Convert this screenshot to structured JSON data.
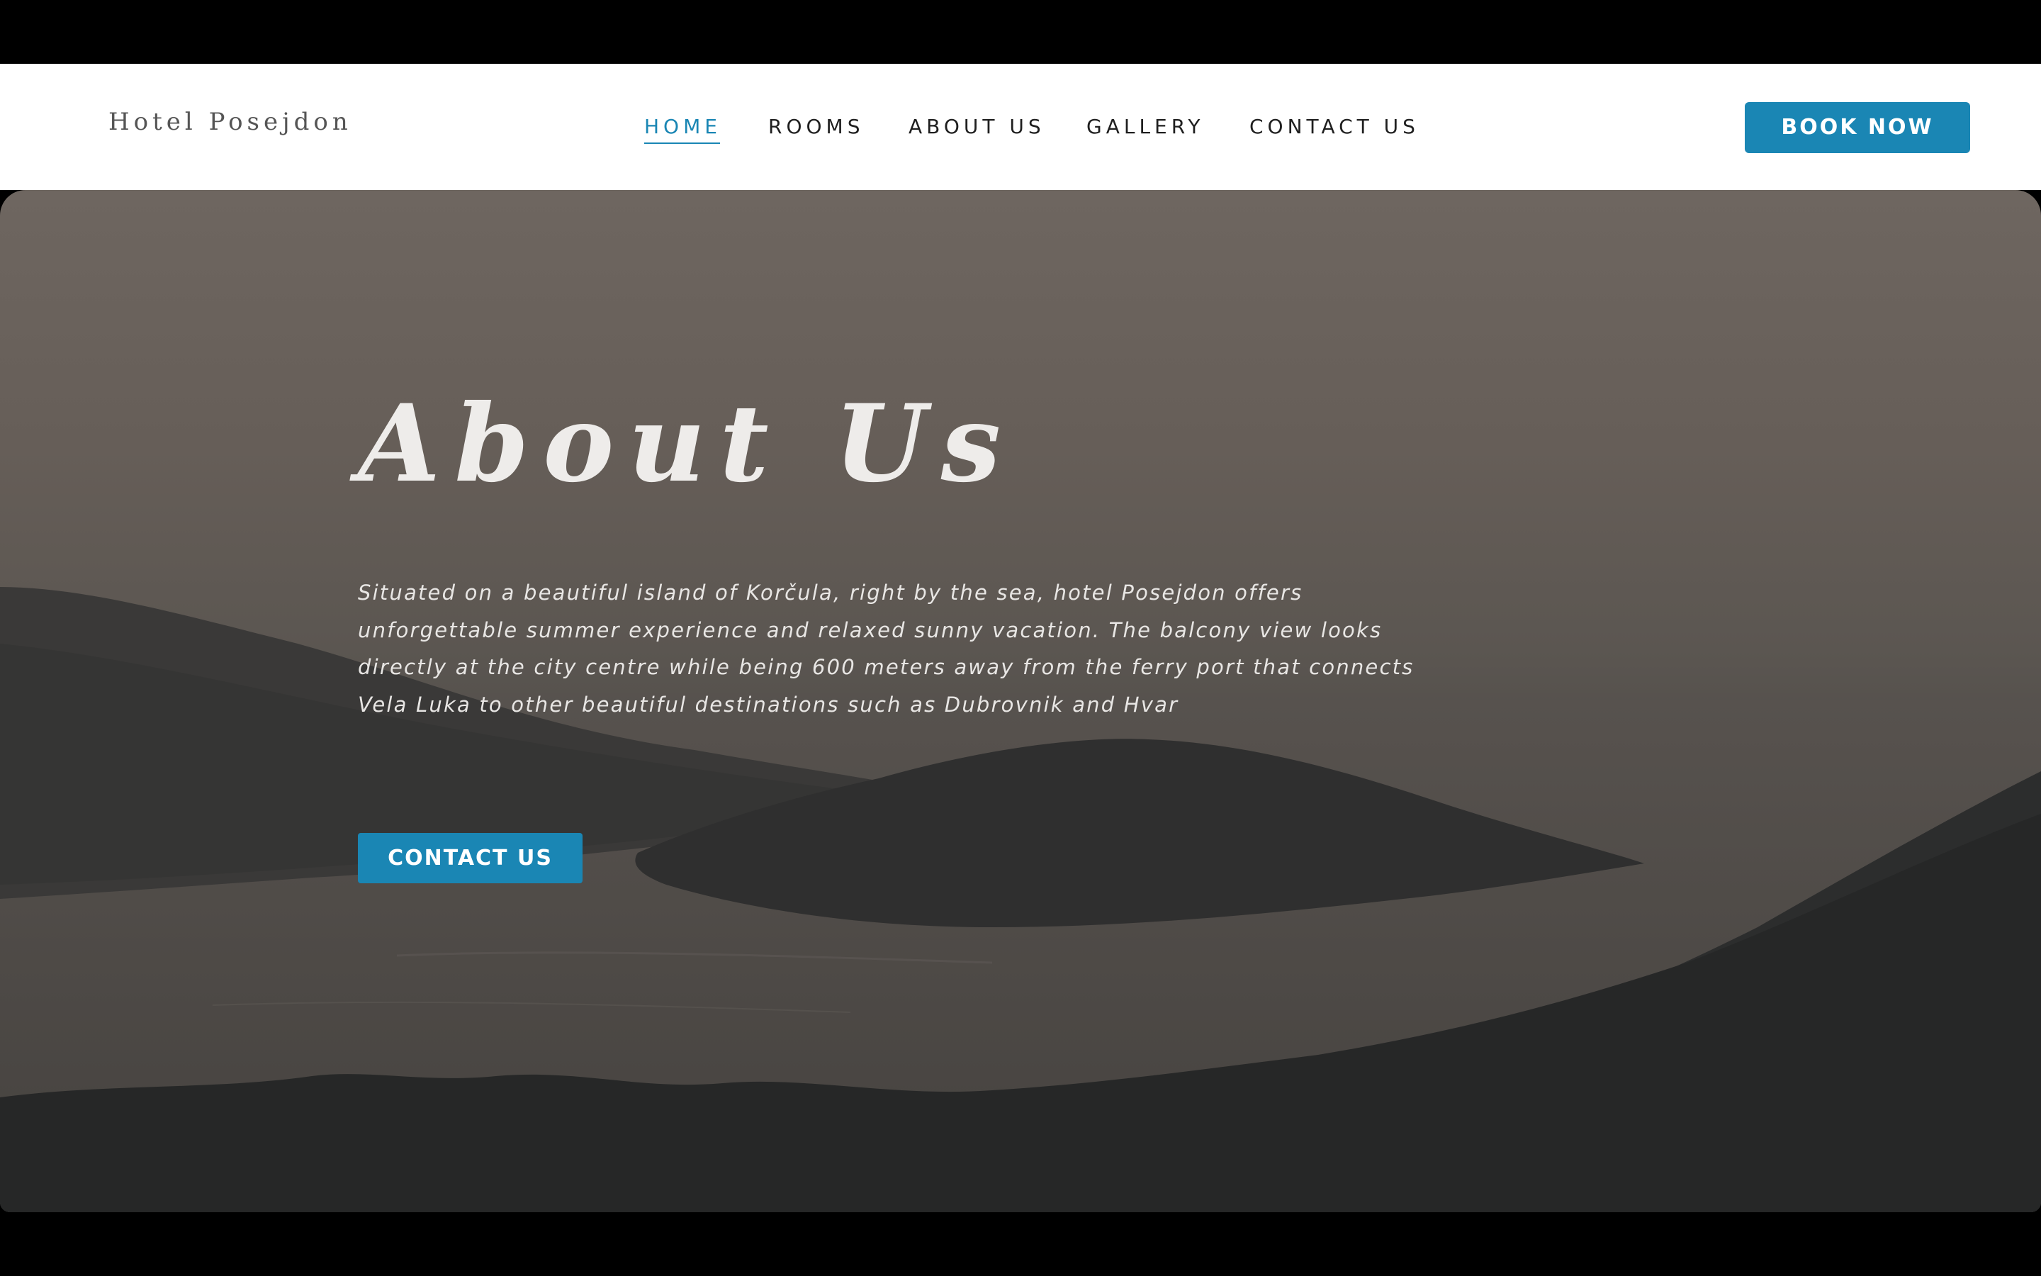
{
  "header": {
    "logo_text": "Hotel Posejdon",
    "nav": [
      {
        "label": "HOME",
        "active": true
      },
      {
        "label": "ROOMS",
        "active": false
      },
      {
        "label": "ABOUT US",
        "active": false
      },
      {
        "label": "GALLERY",
        "active": false
      },
      {
        "label": "CONTACT US",
        "active": false
      }
    ],
    "book_label": "BOOK NOW"
  },
  "hero": {
    "title": "About Us",
    "description": "Situated on a beautiful island of Korčula, right by the sea, hotel Posejdon offers unforgettable summer experience and relaxed sunny vacation. The balcony view looks directly at the city centre while being 600 meters away from the ferry port that connects Vela Luka to other beautiful destinations such as Dubrovnik and Hvar",
    "cta_label": "CONTACT US"
  },
  "colors": {
    "accent": "#1a86b4",
    "nav_text": "#1f1f1f",
    "hero_text": "#eeecea"
  }
}
